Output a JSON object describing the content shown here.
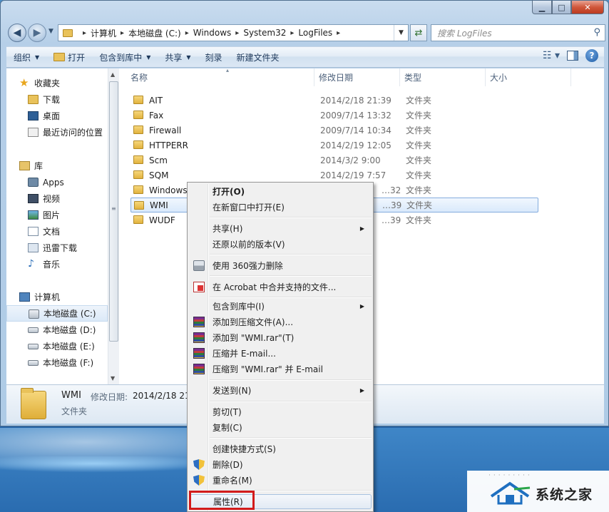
{
  "window": {
    "caption_min": "▁",
    "caption_max": "□",
    "caption_close": "✕"
  },
  "nav": {
    "back_glyph": "◀",
    "forward_glyph": "▶",
    "breadcrumb": [
      "计算机",
      "本地磁盘 (C:)",
      "Windows",
      "System32",
      "LogFiles"
    ],
    "search_placeholder": "搜索 LogFiles"
  },
  "toolbar": {
    "organize": "组织",
    "open": "打开",
    "include_in_library": "包含到库中",
    "share": "共享",
    "burn": "刻录",
    "new_folder": "新建文件夹"
  },
  "sidebar": {
    "favorites": {
      "label": "收藏夹",
      "items": [
        "下载",
        "桌面",
        "最近访问的位置"
      ]
    },
    "libraries": {
      "label": "库",
      "items": [
        "Apps",
        "视频",
        "图片",
        "文档",
        "迅雷下载",
        "音乐"
      ]
    },
    "computer": {
      "label": "计算机",
      "items": [
        "本地磁盘 (C:)",
        "本地磁盘 (D:)",
        "本地磁盘 (E:)",
        "本地磁盘 (F:)"
      ]
    }
  },
  "columns": {
    "name": "名称",
    "modified": "修改日期",
    "type": "类型",
    "size": "大小"
  },
  "files": [
    {
      "name": "AIT",
      "date": "2014/2/18 21:39",
      "type": "文件夹"
    },
    {
      "name": "Fax",
      "date": "2009/7/14 13:32",
      "type": "文件夹"
    },
    {
      "name": "Firewall",
      "date": "2009/7/14 10:34",
      "type": "文件夹"
    },
    {
      "name": "HTTPERR",
      "date": "2014/2/19 12:05",
      "type": "文件夹"
    },
    {
      "name": "Scm",
      "date": "2014/3/2 9:00",
      "type": "文件夹"
    },
    {
      "name": "SQM",
      "date": "2014/2/19 7:57",
      "type": "文件夹"
    },
    {
      "name": "Windows",
      "date": "…32",
      "type": "文件夹"
    },
    {
      "name": "WMI",
      "date": "…39",
      "type": "文件夹"
    },
    {
      "name": "WUDF",
      "date": "…39",
      "type": "文件夹"
    }
  ],
  "details": {
    "name": "WMI",
    "modified_label": "修改日期:",
    "modified_value": "2014/2/18 21:",
    "type": "文件夹"
  },
  "context_menu": {
    "items": [
      {
        "label": "打开(O)",
        "bold": true
      },
      {
        "label": "在新窗口中打开(E)"
      },
      {
        "label": "共享(H)",
        "submenu": true
      },
      {
        "label": "还原以前的版本(V)"
      },
      {
        "label": "使用 360强力删除",
        "icon": "shredder-icon"
      },
      {
        "label": "在 Acrobat 中合并支持的文件...",
        "icon": "acrobat-icon"
      },
      {
        "label": "包含到库中(I)",
        "submenu": true
      },
      {
        "label": "添加到压缩文件(A)...",
        "icon": "winrar-icon"
      },
      {
        "label": "添加到 \"WMI.rar\"(T)",
        "icon": "winrar-icon"
      },
      {
        "label": "压缩并 E-mail...",
        "icon": "winrar-icon"
      },
      {
        "label": "压缩到 \"WMI.rar\" 并 E-mail",
        "icon": "winrar-icon"
      },
      {
        "label": "发送到(N)",
        "submenu": true
      },
      {
        "label": "剪切(T)"
      },
      {
        "label": "复制(C)"
      },
      {
        "label": "创建快捷方式(S)"
      },
      {
        "label": "删除(D)",
        "icon": "uac-shield-icon"
      },
      {
        "label": "重命名(M)",
        "icon": "uac-shield-icon"
      },
      {
        "label": "属性(R)",
        "highlighted": true
      }
    ]
  },
  "watermark": {
    "text": "系统之家"
  },
  "colors": {
    "highlight_box": "#d21b1b",
    "selection_border": "#84acdd"
  }
}
